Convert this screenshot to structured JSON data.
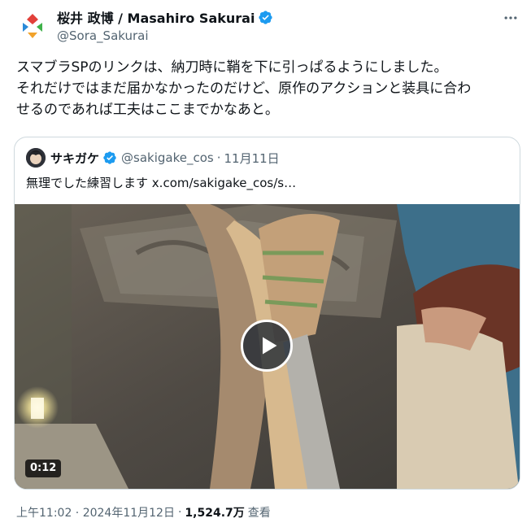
{
  "author": {
    "display_name": "桜井 政博 / Masahiro Sakurai",
    "handle": "@Sora_Sakurai",
    "verified": true
  },
  "tweet": {
    "lines": [
      "スマブラSPのリンクは、納刀時に鞘を下に引っぱるようにしました。",
      "それだけではまだ届かなかったのだけど、原作のアクションと装具に合わ",
      "せるのであれば工夫はここまでかなあと。"
    ]
  },
  "quote": {
    "display_name": "サキガケ",
    "handle": "@sakigake_cos",
    "separator": "·",
    "date": "11月11日",
    "text": "無理でした練習します",
    "link": "x.com/sakigake_cos/s…",
    "video_duration": "0:12"
  },
  "meta": {
    "timestamp": "上午11:02 · 2024年11月12日",
    "separator": "·",
    "views": "1,524.7万",
    "views_label": "查看"
  },
  "colors": {
    "verified_blue": "#1d9bf0",
    "text_primary": "#0f1419",
    "text_secondary": "#536471",
    "border": "#cfd9de"
  },
  "icons": {
    "more": "more-horizontal-icon",
    "verified": "verified-badge-icon",
    "play": "play-icon"
  }
}
